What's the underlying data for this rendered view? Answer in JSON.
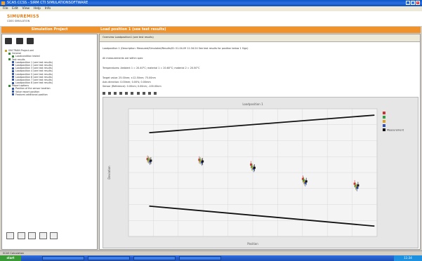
{
  "window": {
    "title": "SCA5 CCSS - SIRM CTI SIMULATIONSOFTWARE",
    "buttons": [
      "_",
      "□",
      "×"
    ]
  },
  "menu": [
    "File",
    "Edit",
    "View",
    "Help",
    "Info"
  ],
  "logo": {
    "text": "SIMUREMIS5",
    "subtitle": "CDSS SIMULATION"
  },
  "left_header": "Simulation Project",
  "right_header": "Load position 1 (see test results)",
  "tree": [
    "SIM TRAIN Project.xml",
    "General",
    "Loadcondition tested",
    "Test results",
    "Loadposition 1 (see test results)",
    "Loadposition 2 (see test results)",
    "Loadposition 3 (see test results)",
    "Loadposition 4 (see test results)",
    "Loadposition 5 (see test results)",
    "Loadposition 6 (see test results)",
    "Loadposition 7 (see test results)",
    "Loadposition 8 (see test results)",
    "Report options",
    "Position of the sensor location",
    "Value report position",
    "Features additional position"
  ],
  "right_tab": "Overview   Loadposition1 (see test results)",
  "info_lines": [
    "Loadposition 1 (Description: Measured/Simulated/Results/ID: 01-04-09  11:34:24  See test results for position below 1 Sign)",
    "All measurements are within spec",
    "Temperatures: Ambient 1 = 20.40°C; material 1 = 20.60°C; material 2 = 20.50°C",
    "Target value: 25.00nm; ±12.50nm; 75.00nm",
    "Axis direction: 0.00mm; 0.00%; 0.00mm",
    "Sensor (Reference): 0.00nm; 0.00nm; -100.00nm"
  ],
  "status": "SCA5 Calculation",
  "taskbar": {
    "start": "start",
    "clock": "11:34"
  },
  "chart_data": {
    "type": "scatter",
    "title": "Loadposition 1",
    "xlabel": "Position",
    "ylabel": "Deviation",
    "x": [
      1,
      2,
      3,
      4,
      5
    ],
    "series": [
      {
        "name": "",
        "color": "#d03030",
        "values": [
          0.17,
          0.16,
          0.1,
          -0.08,
          -0.14
        ]
      },
      {
        "name": "",
        "color": "#30a040",
        "values": [
          0.16,
          0.15,
          0.07,
          -0.1,
          -0.17
        ]
      },
      {
        "name": "",
        "color": "#e0a020",
        "values": [
          0.15,
          0.14,
          0.06,
          -0.12,
          -0.18
        ]
      },
      {
        "name": "",
        "color": "#3050c0",
        "values": [
          0.14,
          0.13,
          0.05,
          -0.13,
          -0.19
        ]
      },
      {
        "name": "Measurement",
        "color": "#111111",
        "values": [
          0.15,
          0.14,
          0.06,
          -0.11,
          -0.16
        ]
      }
    ],
    "upper_limit": [
      0.5,
      0.72
    ],
    "lower_limit": [
      -0.42,
      -0.67
    ],
    "ylim": [
      -0.8,
      0.8
    ],
    "grid": true,
    "legend": "top-right"
  }
}
